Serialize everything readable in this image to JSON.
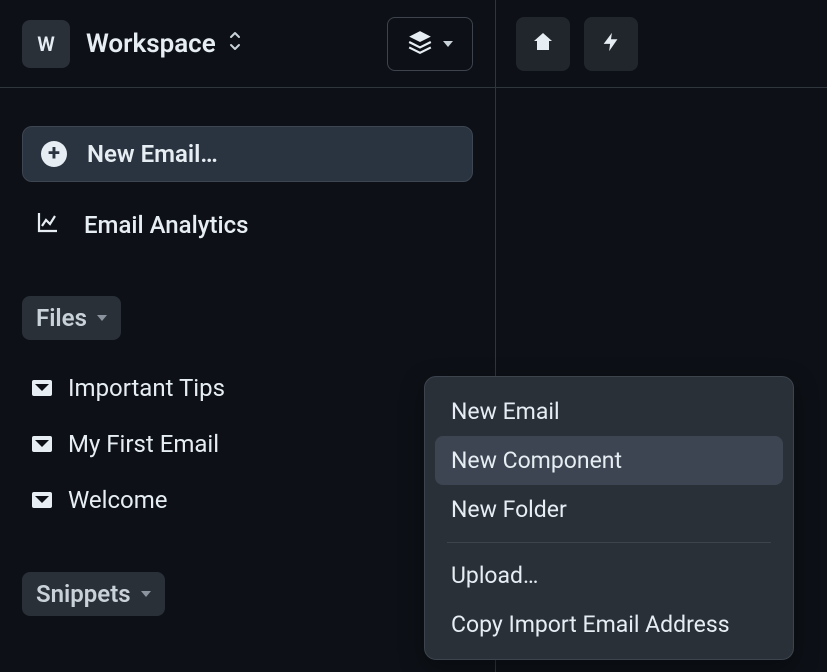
{
  "header": {
    "workspace_initial": "W",
    "workspace_name": "Workspace"
  },
  "sidebar": {
    "new_email_label": "New Email…",
    "analytics_label": "Email Analytics",
    "files_header": "Files",
    "files": [
      {
        "name": "Important Tips"
      },
      {
        "name": "My First Email"
      },
      {
        "name": "Welcome"
      }
    ],
    "snippets_header": "Snippets"
  },
  "context_menu": {
    "items": [
      {
        "label": "New Email",
        "highlighted": false
      },
      {
        "label": "New Component",
        "highlighted": true
      },
      {
        "label": "New Folder",
        "highlighted": false
      }
    ],
    "items2": [
      {
        "label": "Upload…"
      },
      {
        "label": "Copy Import Email Address"
      }
    ]
  }
}
